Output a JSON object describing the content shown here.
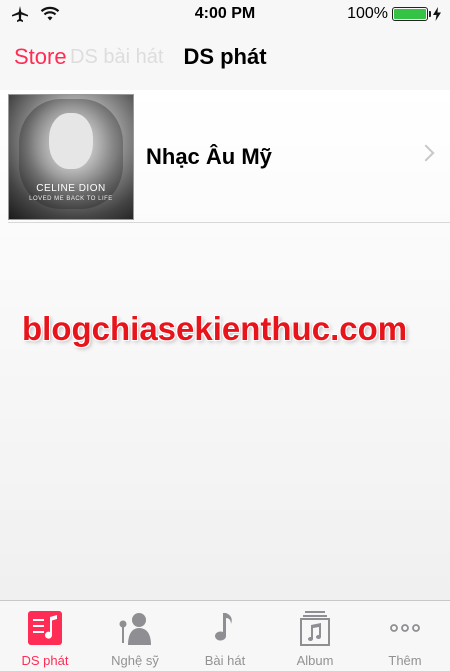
{
  "status_bar": {
    "airplane_icon": "airplane-icon",
    "wifi_icon": "wifi-icon",
    "time": "4:00 PM",
    "battery_percent": "100%",
    "battery_level": 1.0,
    "charging_icon": "bolt-icon"
  },
  "navbar": {
    "back_label": "Store",
    "ghost_label": "DS bài hát",
    "title": "DS phát"
  },
  "playlist_rows": [
    {
      "title": "Nhạc Âu Mỹ",
      "art_title": "CELINE DION",
      "art_subtitle": "LOVED ME BACK TO LIFE",
      "chevron_icon": "chevron-right-icon"
    }
  ],
  "watermark": "blogchiasekienthuc.com",
  "tabbar": {
    "tabs": [
      {
        "label": "DS phát",
        "icon": "playlist-icon",
        "active": true
      },
      {
        "label": "Nghệ sỹ",
        "icon": "artist-icon",
        "active": false
      },
      {
        "label": "Bài hát",
        "icon": "music-note-icon",
        "active": false
      },
      {
        "label": "Album",
        "icon": "album-icon",
        "active": false
      },
      {
        "label": "Thêm",
        "icon": "more-icon",
        "active": false
      }
    ]
  },
  "colors": {
    "accent": "#ff2d55",
    "inactive": "#929292",
    "battery": "#35c346",
    "watermark": "#e8141b"
  }
}
